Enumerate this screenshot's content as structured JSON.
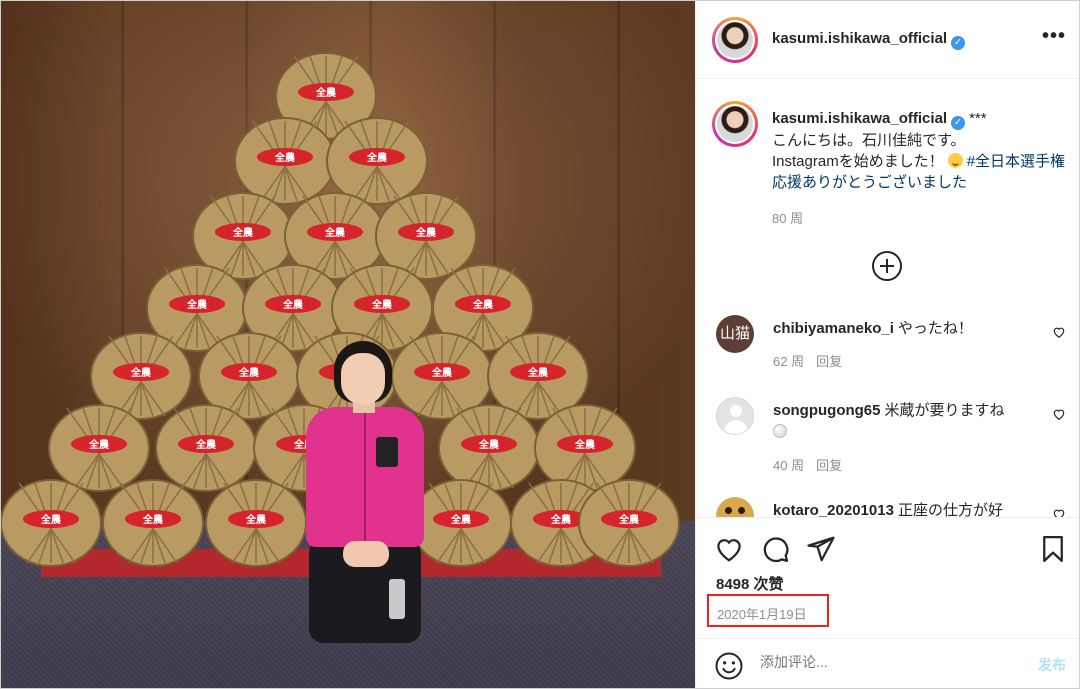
{
  "photo": {
    "bale_label": "全農"
  },
  "header": {
    "username": "kasumi.ishikawa_official",
    "verified_mark": "✓",
    "more_label": "•••"
  },
  "caption": {
    "username": "kasumi.ishikawa_official",
    "verified_mark": "✓",
    "stars": "***",
    "line1": "こんにちは。石川佳純です。",
    "line2": "Instagramを始めました！",
    "hashtag": "#全日本選手権応援ありがとうございました",
    "time": "80 周"
  },
  "comments": [
    {
      "avatar_text": "山猫",
      "username": "chibiyamaneko_i",
      "text": "やったね！",
      "time": "62 周",
      "reply": "回复"
    },
    {
      "avatar_text": "",
      "username": "songpugong65",
      "text": "米蔵が要りますね",
      "time": "40 周",
      "reply": "回复"
    },
    {
      "avatar_text": "",
      "username": "kotaro_20201013",
      "text": "正座の仕方が好"
    }
  ],
  "actions": {
    "likes": "8498 次赞",
    "date": "2020年1月19日",
    "comment_placeholder": "添加评论...",
    "post_label": "发布"
  },
  "colors": {
    "accent_link": "#00376b",
    "verified": "#3897f0",
    "highlight_box": "#e8241c",
    "post_disabled": "#b2dffc"
  }
}
